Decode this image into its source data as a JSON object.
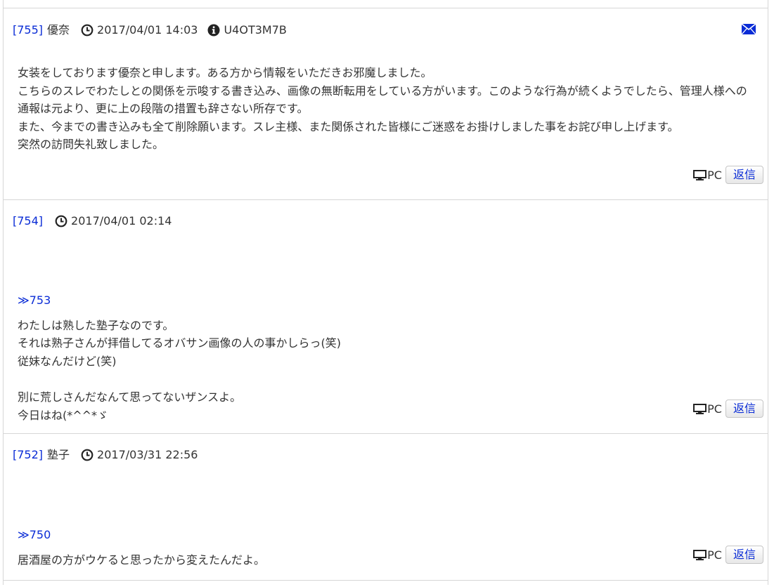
{
  "posts": [
    {
      "number": "[755]",
      "author": "優奈",
      "date": "2017/04/01 14:03",
      "user_id": "U4OT3M7B",
      "anchor": "",
      "body": "女装をしております優奈と申します。ある方から情報をいただきお邪魔しました。\nこちらのスレでわたしとの関係を示唆する書き込み、画像の無断転用をしている方がいます。このような行為が続くようでしたら、管理人様への通報は元より、更に上の段階の措置も辞さない所存です。\nまた、今までの書き込みも全て削除願います。スレ主様、また関係された皆様にご迷惑をお掛けしました事をお詫び申し上げます。\n突然の訪問失礼致しました。",
      "device": "PC",
      "reply_label": "返信"
    },
    {
      "number": "[754]",
      "author": "",
      "date": "2017/04/01 02:14",
      "user_id": "",
      "anchor": "≫753",
      "body": "わたしは熟した塾子なのです。\nそれは熟子さんが拝借してるオバサン画像の人の事かしらっ(笑)\n従妹なんだけど(笑)\n\n別に荒しさんだなんて思ってないザンスよ。\n今日はね(*^^*ゞ",
      "device": "PC",
      "reply_label": "返信"
    },
    {
      "number": "[752]",
      "author": "塾子",
      "date": "2017/03/31 22:56",
      "user_id": "",
      "anchor": "≫750",
      "body": "居酒屋の方がウケると思ったから変えたんだよ。",
      "device": "PC",
      "reply_label": "返信"
    }
  ],
  "icons": {
    "clock": "clock-icon",
    "info": "info-icon",
    "mail": "mail-icon",
    "monitor": "monitor-icon"
  },
  "colors": {
    "link": "#0a2cd6",
    "text": "#333333",
    "border": "#d6d6d6"
  }
}
